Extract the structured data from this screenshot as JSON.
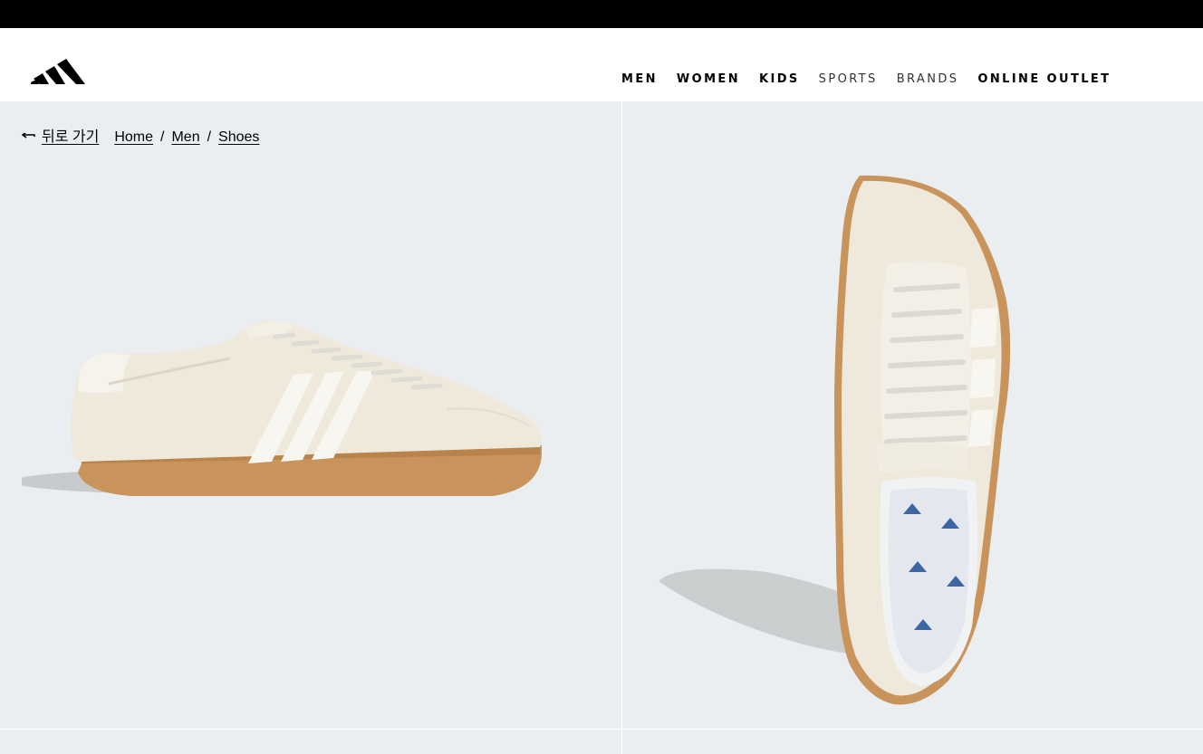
{
  "brand": {
    "logo_icon": "adidas-performance-logo"
  },
  "nav": {
    "items": [
      {
        "label": "MEN",
        "style": "bold"
      },
      {
        "label": "WOMEN",
        "style": "bold"
      },
      {
        "label": "KIDS",
        "style": "bold"
      },
      {
        "label": "SPORTS",
        "style": "light"
      },
      {
        "label": "BRANDS",
        "style": "light"
      },
      {
        "label": "ONLINE OUTLET",
        "style": "bold"
      }
    ]
  },
  "breadcrumb": {
    "back_label": "뒤로 가기",
    "items": [
      "Home",
      "Men",
      "Shoes"
    ],
    "separator": "/"
  },
  "gallery": {
    "images": [
      {
        "name": "product-image-side-view",
        "sole_color": "#c8945c",
        "upper_color": "#efe9dc"
      },
      {
        "name": "product-image-top-view",
        "sole_color": "#c8945c",
        "upper_color": "#efe9dc"
      }
    ],
    "background": "#eaeef0"
  },
  "colors": {
    "topbar": "#000000",
    "header_bg": "#ffffff",
    "text": "#000000"
  }
}
